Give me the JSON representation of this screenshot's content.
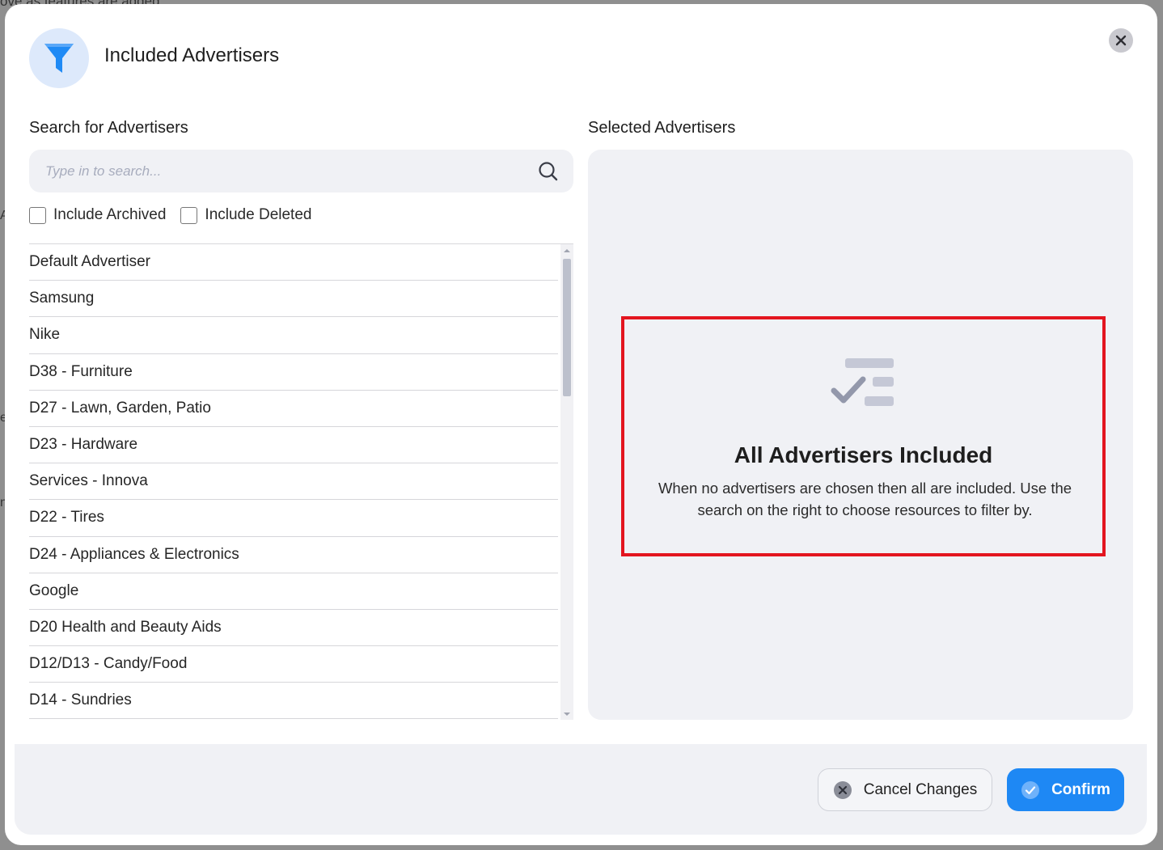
{
  "background": {
    "partial_text": "ove as features are added",
    "edge_chars": [
      "A",
      "e",
      "n"
    ]
  },
  "modal": {
    "title": "Included Advertisers",
    "header_icon": "filter-icon",
    "close_icon": "close-icon"
  },
  "search": {
    "label": "Search for Advertisers",
    "placeholder": "Type in to search...",
    "value": "",
    "icon": "search-icon"
  },
  "filters": {
    "include_archived": {
      "label": "Include Archived",
      "checked": false
    },
    "include_deleted": {
      "label": "Include Deleted",
      "checked": false
    }
  },
  "advertisers": [
    "Default Advertiser",
    "Samsung",
    "Nike",
    "D38 - Furniture",
    "D27 - Lawn, Garden, Patio",
    "D23 - Hardware",
    "Services - Innova",
    "D22 - Tires",
    "D24 - Appliances & Electronics",
    "Google",
    "D20 Health and Beauty Aids",
    "D12/D13 - Candy/Food",
    "D14 - Sundries"
  ],
  "selected": {
    "label": "Selected Advertisers",
    "empty_icon": "checklist-icon",
    "empty_title": "All Advertisers Included",
    "empty_description": "When no advertisers are chosen then all are included. Use the search on the right to choose resources to filter by."
  },
  "footer": {
    "cancel_label": "Cancel Changes",
    "confirm_label": "Confirm"
  },
  "colors": {
    "accent": "#1e88f4",
    "highlight_border": "#e3151f",
    "panel_bg": "#f0f1f5"
  }
}
